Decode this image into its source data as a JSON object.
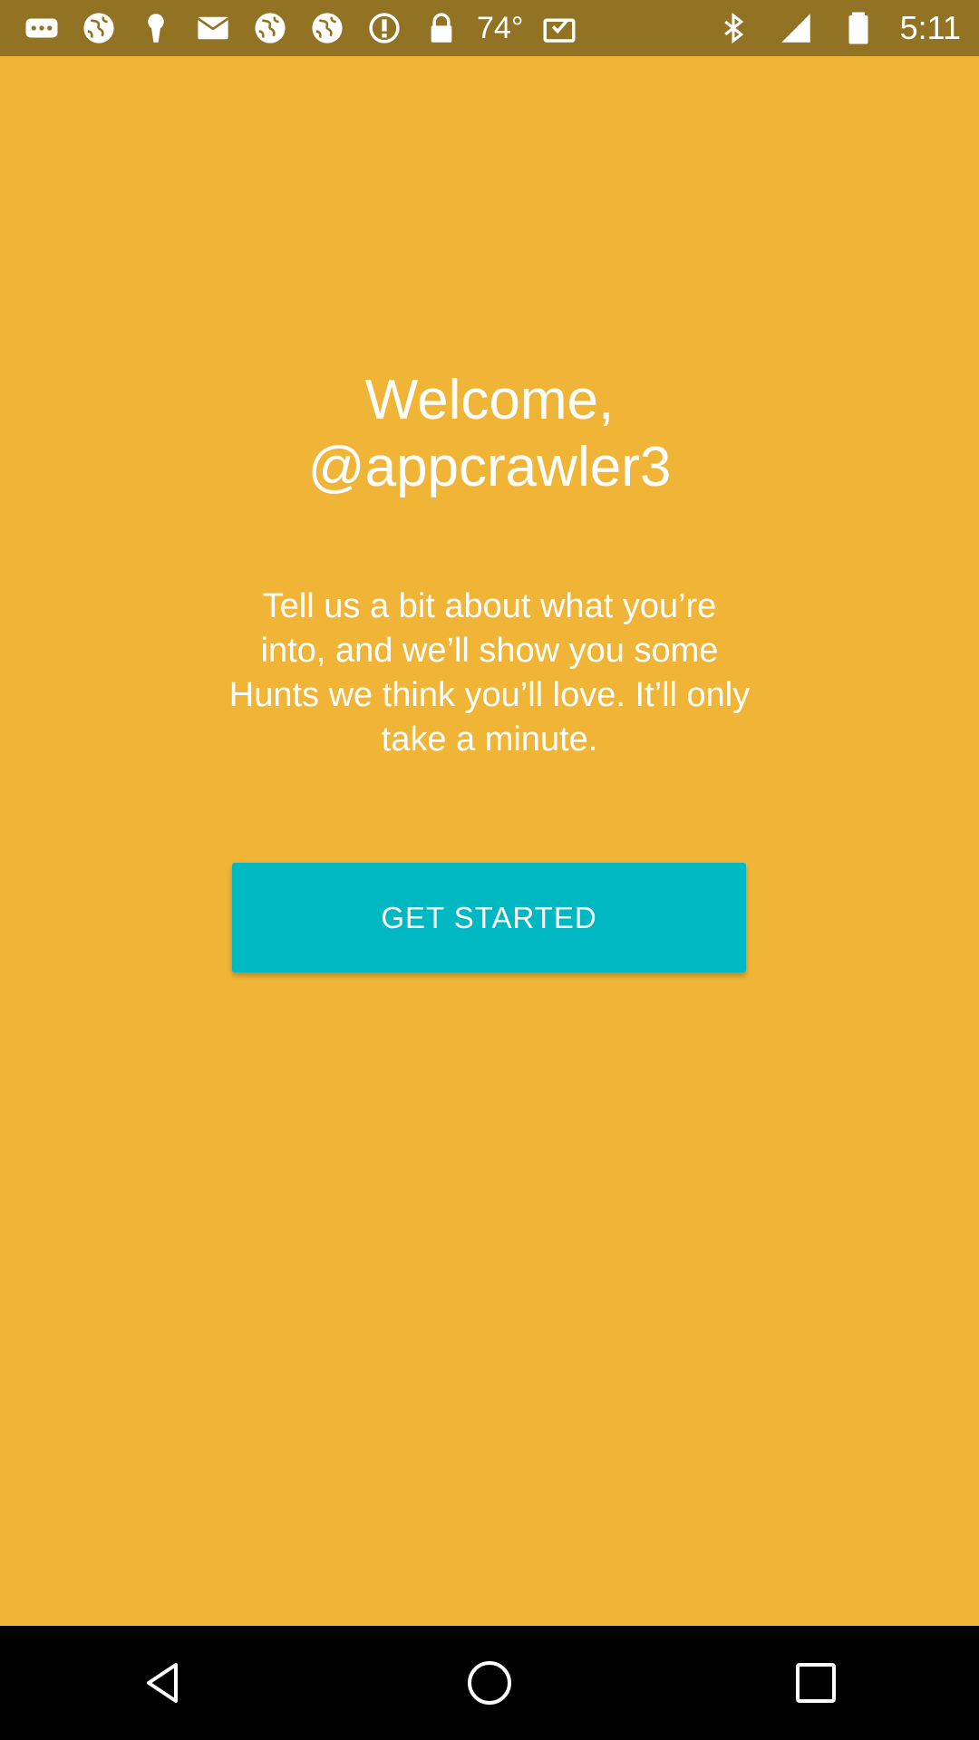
{
  "status_bar": {
    "left_icons": [
      "more-notifications-icon",
      "globe-icon",
      "keyhole-icon",
      "mail-icon",
      "globe-icon",
      "globe-icon",
      "alert-icon",
      "lock-icon"
    ],
    "temperature": "74°",
    "right_icons": [
      "inbox-icon",
      "bluetooth-icon",
      "signal-icon",
      "battery-icon"
    ],
    "time": "5:11",
    "background_color": "#927223"
  },
  "welcome": {
    "line1": "Welcome,",
    "line2": "@appcrawler3"
  },
  "subtitle": "Tell us a bit about what you’re into, and we’ll show you some Hunts we think you’ll love. It’ll only take a minute.",
  "cta": {
    "label": "GET STARTED",
    "color": "#00B8C2"
  },
  "theme": {
    "background": "#F0B437",
    "text": "#FFFFFF"
  },
  "nav_bar": {
    "buttons": [
      "back-icon",
      "home-icon",
      "recents-icon"
    ]
  }
}
